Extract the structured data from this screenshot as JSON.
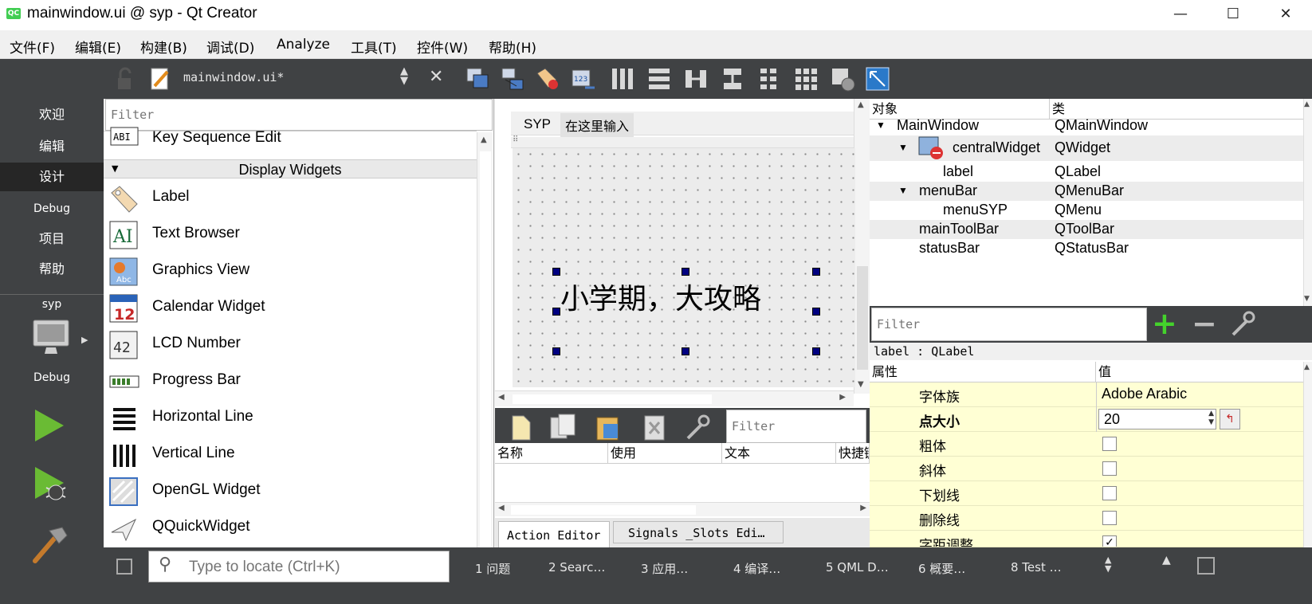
{
  "window": {
    "app_icon": "QC",
    "title": "mainwindow.ui @ syp - Qt Creator",
    "minimize": "—",
    "maximize": "☐",
    "close": "✕"
  },
  "menubar": [
    "文件(F)",
    "编辑(E)",
    "构建(B)",
    "调试(D)",
    "Analyze",
    "工具(T)",
    "控件(W)",
    "帮助(H)"
  ],
  "modes": {
    "items": [
      "欢迎",
      "编辑",
      "设计",
      "Debug",
      "项目",
      "帮助"
    ],
    "selected": "设计",
    "project": "syp",
    "build_config": "Debug"
  },
  "editor_toolbar": {
    "file": "mainwindow.ui*"
  },
  "widget_box": {
    "filter_placeholder": "Filter",
    "above_item": "Key Sequence Edit",
    "category": "Display Widgets",
    "items": [
      "Label",
      "Text Browser",
      "Graphics View",
      "Calendar Widget",
      "LCD Number",
      "Progress Bar",
      "Horizontal Line",
      "Vertical Line",
      "OpenGL Widget",
      "QQuickWidget"
    ]
  },
  "form": {
    "menu_items": [
      "SYP",
      "在这里输入"
    ],
    "label_text": "小学期，大攻略"
  },
  "action_editor": {
    "filter_placeholder": "Filter",
    "columns": [
      "名称",
      "使用",
      "文本",
      "快捷键"
    ],
    "tabs": [
      "Action Editor",
      "Signals _Slots Edi…"
    ]
  },
  "object_inspector": {
    "columns": [
      "对象",
      "类"
    ],
    "rows": [
      {
        "object": "MainWindow",
        "class": "QMainWindow"
      },
      {
        "object": "centralWidget",
        "class": "QWidget"
      },
      {
        "object": "label",
        "class": "QLabel"
      },
      {
        "object": "menuBar",
        "class": "QMenuBar"
      },
      {
        "object": "menuSYP",
        "class": "QMenu"
      },
      {
        "object": "mainToolBar",
        "class": "QToolBar"
      },
      {
        "object": "statusBar",
        "class": "QStatusBar"
      }
    ]
  },
  "property_editor": {
    "filter_placeholder": "Filter",
    "selected_object": "label : QLabel",
    "columns": [
      "属性",
      "值"
    ],
    "rows": [
      {
        "name": "字体族",
        "value": "Adobe Arabic"
      },
      {
        "name": "点大小",
        "value": "20"
      },
      {
        "name": "粗体",
        "value": ""
      },
      {
        "name": "斜体",
        "value": ""
      },
      {
        "name": "下划线",
        "value": ""
      },
      {
        "name": "删除线",
        "value": ""
      },
      {
        "name": "字距调整",
        "value": ""
      }
    ]
  },
  "status_bar": {
    "locate_placeholder": "Type to locate (Ctrl+K)",
    "panes": [
      "1  问题",
      "2  Searc…",
      "3  应用…",
      "4  编译…",
      "5  QML D…",
      "6  概要…",
      "8  Test  …"
    ]
  }
}
